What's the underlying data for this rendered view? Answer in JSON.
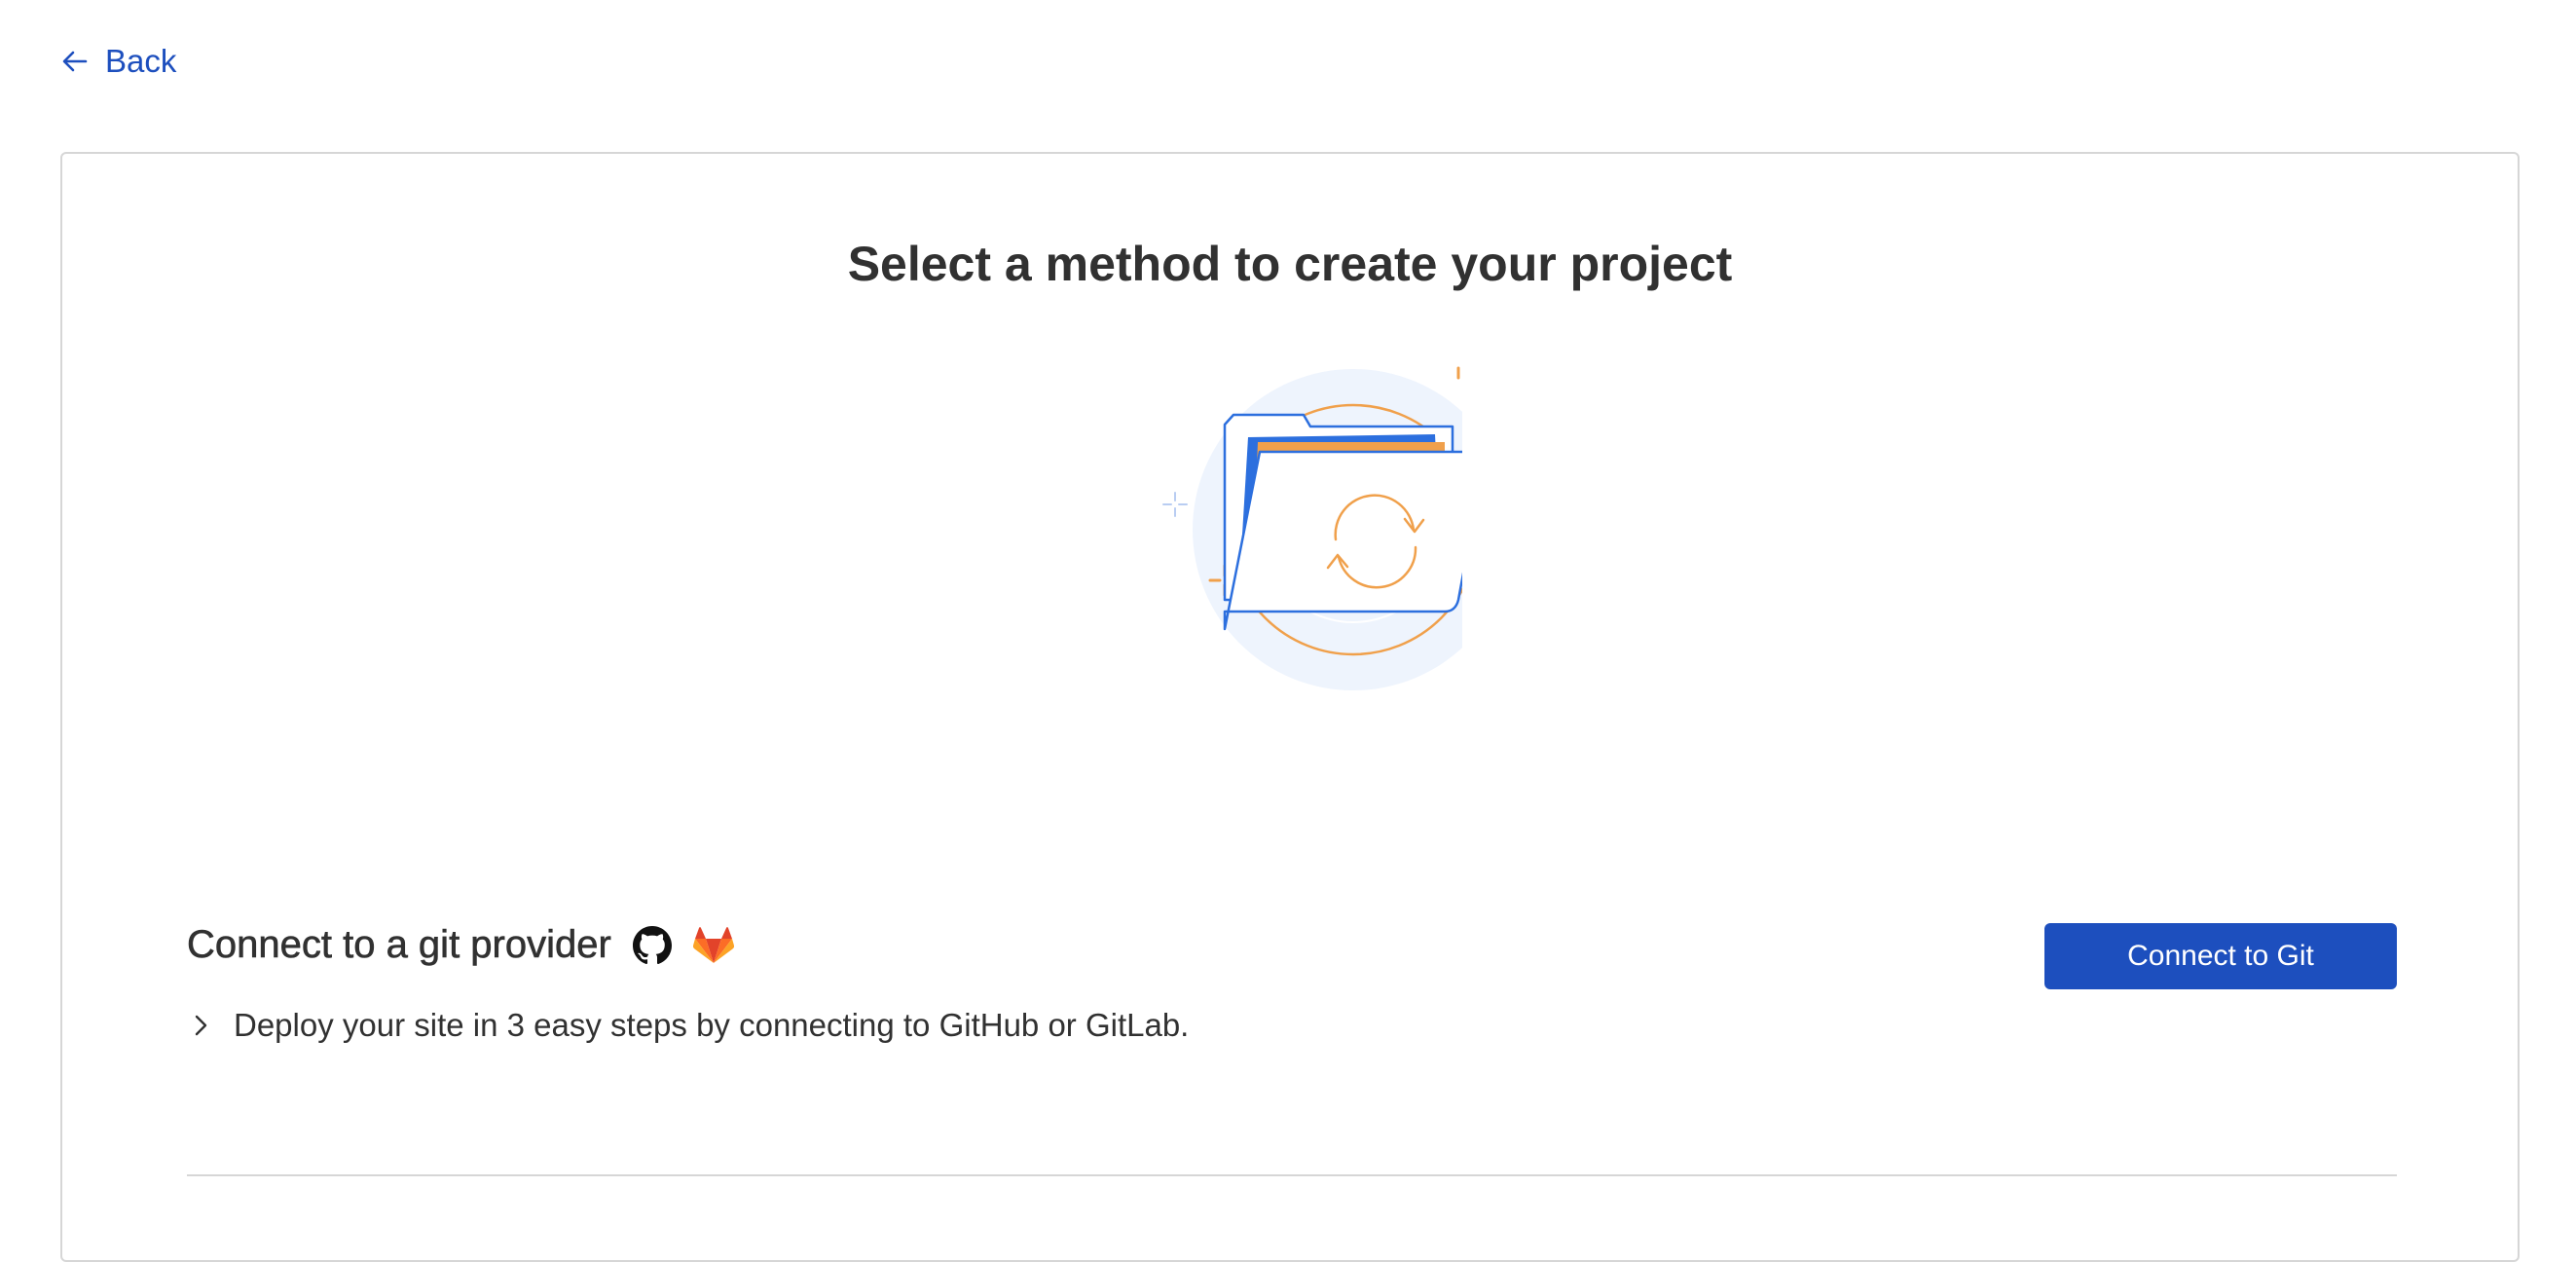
{
  "nav": {
    "back_label": "Back",
    "back_icon": "arrow-left-icon"
  },
  "page": {
    "title": "Select a method to create your project",
    "illustration": "folder-sync-illustration"
  },
  "git_method": {
    "title": "Connect to a git provider",
    "icons": [
      "github-icon",
      "gitlab-icon"
    ],
    "description": "Deploy your site in 3 easy steps by connecting to GitHub or GitLab.",
    "expand_icon": "chevron-right-icon",
    "button_label": "Connect to Git"
  },
  "colors": {
    "accent": "#1d4fbe",
    "text": "#313131",
    "border": "#d6d6d6",
    "illustration_orange": "#f0a04b",
    "illustration_blue": "#2c6fde",
    "illustration_bg": "#eef4fd",
    "gitlab_orange": "#e2432a"
  }
}
